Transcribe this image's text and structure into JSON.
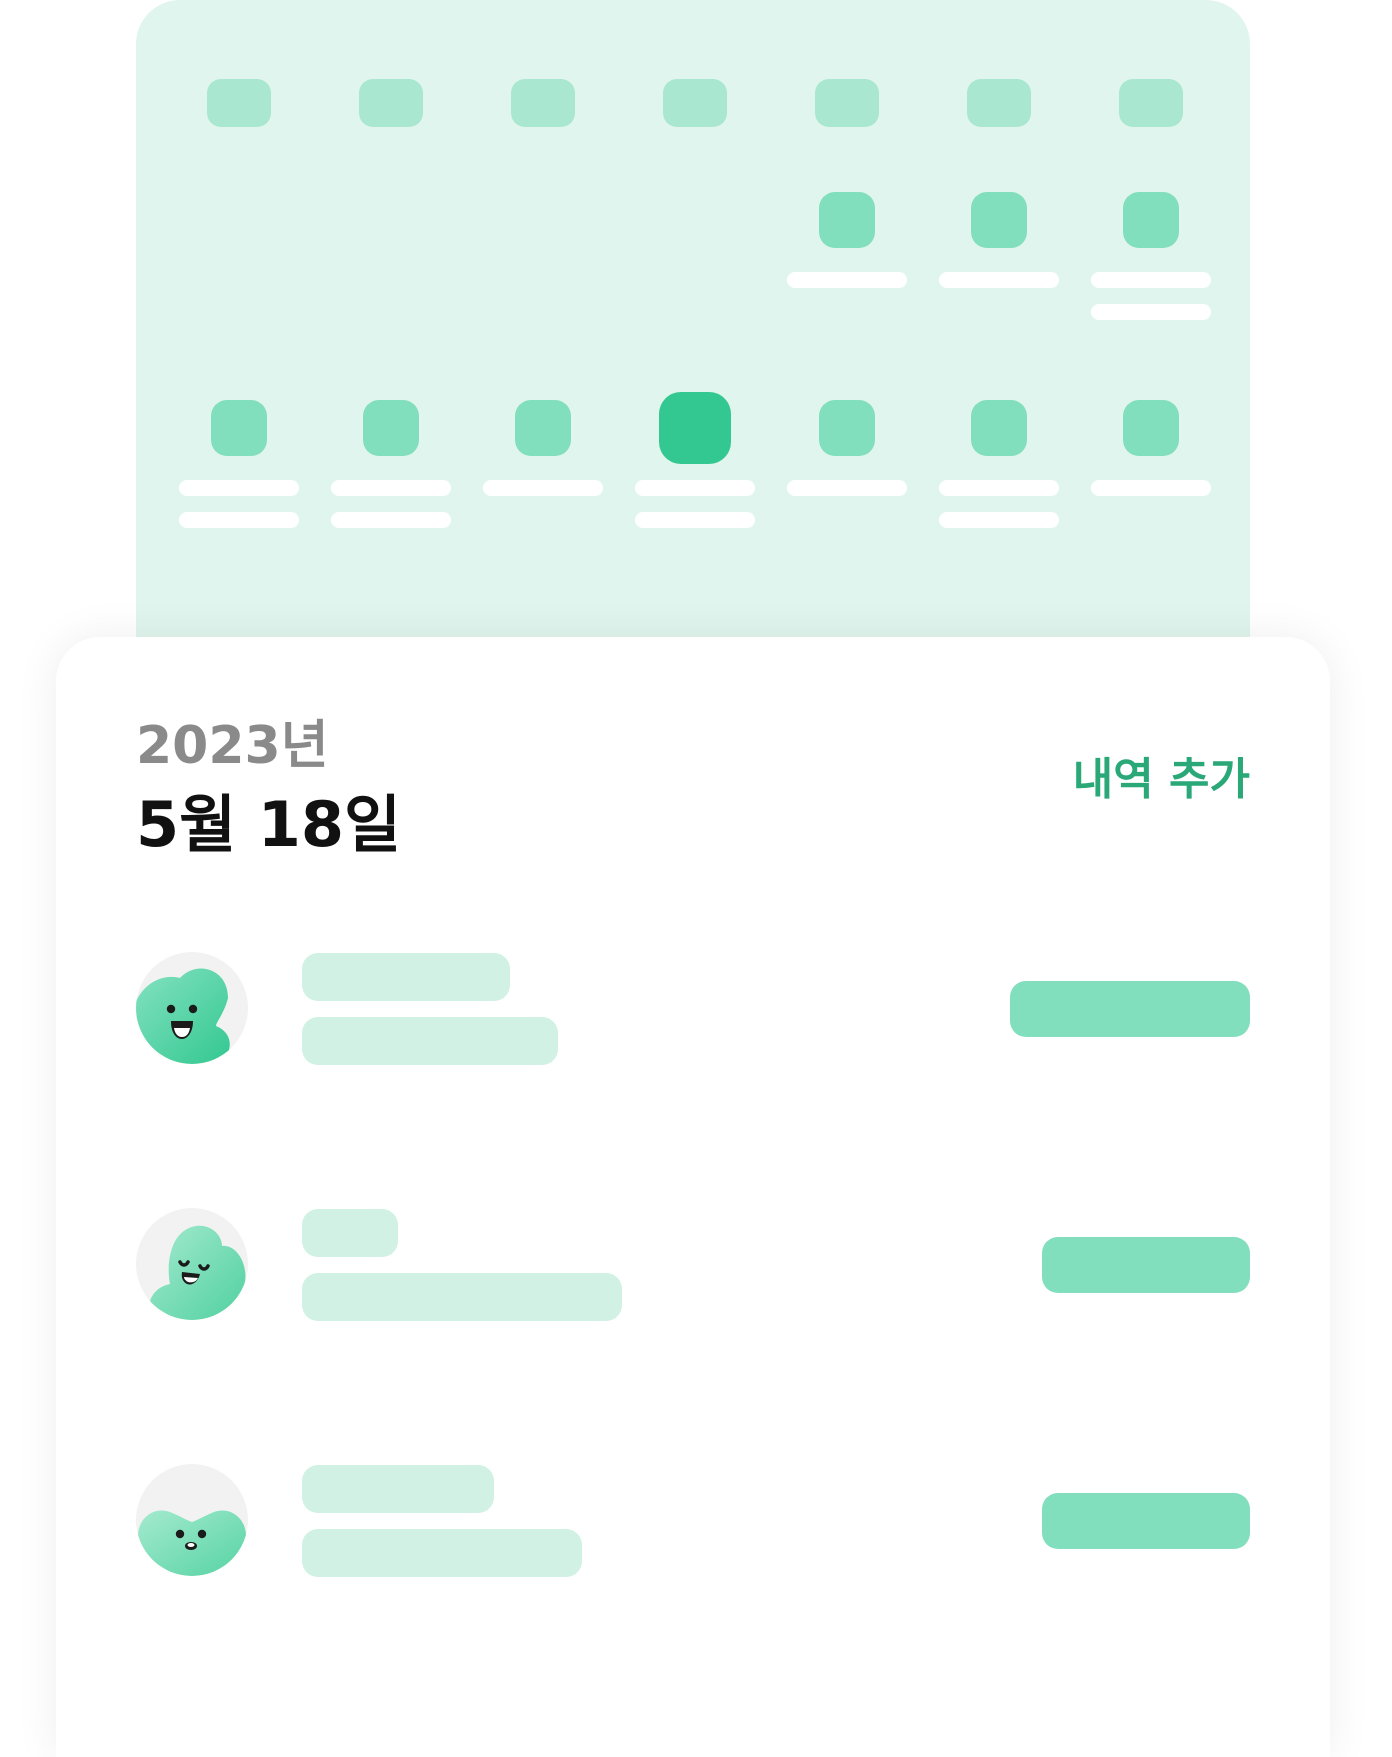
{
  "header": {
    "year": "2023년",
    "date": "5월 18일"
  },
  "actions": {
    "add_label": "내역 추가"
  },
  "theme": {
    "calendar_bg": "#e0f5ed",
    "weekday_placeholder": "#a9e7d0",
    "day_placeholder": "#82dfbd",
    "selected_day": "#33c891",
    "accent_text": "#2aa878",
    "row_placeholder": "#d0f1e4"
  },
  "calendar": {
    "selected_day_index": 3
  },
  "transactions": [
    {
      "avatar_icon": "smiling-leaf-character-icon"
    },
    {
      "avatar_icon": "happy-closed-eyes-character-icon"
    },
    {
      "avatar_icon": "heart-shaped-character-icon"
    }
  ]
}
